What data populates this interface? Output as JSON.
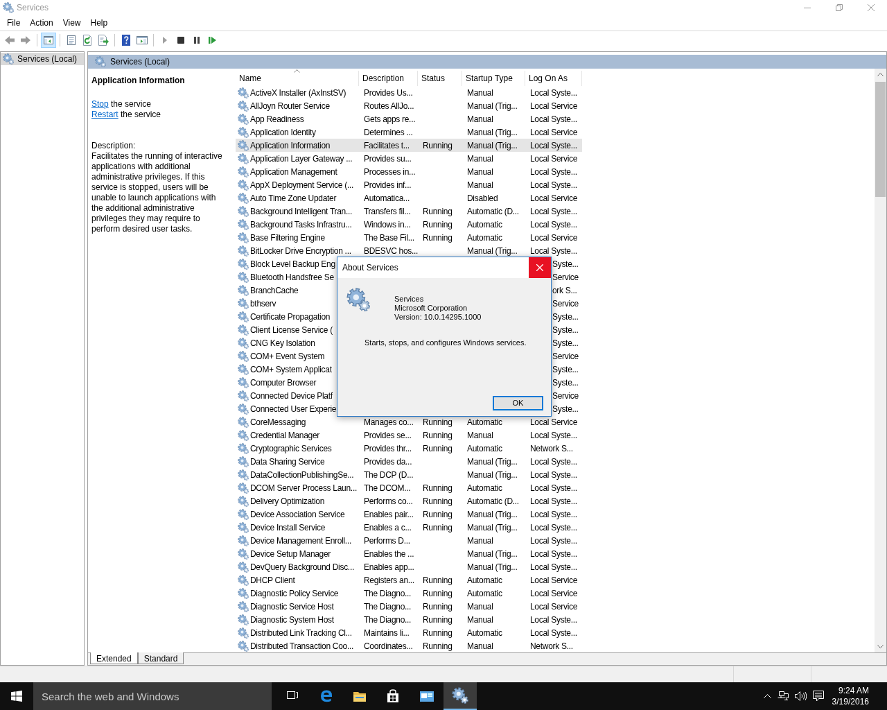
{
  "window": {
    "title": "Services"
  },
  "menu": [
    {
      "label": "File"
    },
    {
      "label": "Action"
    },
    {
      "label": "View"
    },
    {
      "label": "Help"
    }
  ],
  "toolbar": [
    {
      "kind": "back",
      "enabled": false,
      "pressed": false
    },
    {
      "kind": "forward",
      "enabled": false,
      "pressed": false
    },
    {
      "kind": "separator"
    },
    {
      "kind": "tree",
      "enabled": true,
      "pressed": true
    },
    {
      "kind": "separator"
    },
    {
      "kind": "properties",
      "enabled": true,
      "pressed": false
    },
    {
      "kind": "refresh",
      "enabled": true,
      "pressed": false
    },
    {
      "kind": "export",
      "enabled": true,
      "pressed": false
    },
    {
      "kind": "separator"
    },
    {
      "kind": "help",
      "enabled": true,
      "pressed": false
    },
    {
      "kind": "pane",
      "enabled": true,
      "pressed": false
    },
    {
      "kind": "separator"
    },
    {
      "kind": "start",
      "enabled": false,
      "pressed": false
    },
    {
      "kind": "stop",
      "enabled": true,
      "pressed": false
    },
    {
      "kind": "pause",
      "enabled": true,
      "pressed": false
    },
    {
      "kind": "resume",
      "enabled": true,
      "pressed": false
    }
  ],
  "tree": {
    "items": [
      {
        "label": "Services (Local)",
        "selected": true
      }
    ]
  },
  "pane_header": "Services (Local)",
  "details": {
    "title": "Application Information",
    "actions": [
      {
        "link": "Stop",
        "text": " the service"
      },
      {
        "link": "Restart",
        "text": " the service"
      }
    ],
    "description_label": "Description:",
    "description": "Facilitates the running of interactive applications with additional administrative privileges.  If this service is stopped, users will be unable to launch applications with the additional administrative privileges they may require to perform desired user tasks."
  },
  "table": {
    "columns": [
      {
        "label": "Name",
        "sorted": true
      },
      {
        "label": "Description",
        "sorted": false
      },
      {
        "label": "Status",
        "sorted": false
      },
      {
        "label": "Startup Type",
        "sorted": false
      },
      {
        "label": "Log On As",
        "sorted": false
      }
    ],
    "rows": [
      {
        "kind": "full",
        "name": "ActiveX Installer (AxInstSV)",
        "description": "Provides Us...",
        "startup_type": "Manual",
        "log_on_as": "Local Syste...",
        "selected": false
      },
      {
        "kind": "full",
        "name": "AllJoyn Router Service",
        "description": "Routes AllJo...",
        "startup_type": "Manual (Trig...",
        "log_on_as": "Local Service",
        "selected": false
      },
      {
        "kind": "full",
        "name": "App Readiness",
        "description": "Gets apps re...",
        "startup_type": "Manual",
        "log_on_as": "Local Syste...",
        "selected": false
      },
      {
        "kind": "full",
        "name": "Application Identity",
        "description": "Determines ...",
        "startup_type": "Manual (Trig...",
        "log_on_as": "Local Service",
        "selected": false
      },
      {
        "kind": "full",
        "name": "Application Information",
        "description": "Facilitates t...",
        "status": "Running",
        "startup_type": "Manual (Trig...",
        "log_on_as": "Local Syste...",
        "selected": true
      },
      {
        "kind": "full",
        "name": "Application Layer Gateway ...",
        "description": "Provides su...",
        "startup_type": "Manual",
        "log_on_as": "Local Service",
        "selected": false
      },
      {
        "kind": "full",
        "name": "Application Management",
        "description": "Processes in...",
        "startup_type": "Manual",
        "log_on_as": "Local Syste...",
        "selected": false
      },
      {
        "kind": "full",
        "name": "AppX Deployment Service (...",
        "description": "Provides inf...",
        "startup_type": "Manual",
        "log_on_as": "Local Syste...",
        "selected": false
      },
      {
        "kind": "full",
        "name": "Auto Time Zone Updater",
        "description": "Automatica...",
        "startup_type": "Disabled",
        "log_on_as": "Local Service",
        "selected": false
      },
      {
        "kind": "full",
        "name": "Background Intelligent Tran...",
        "description": "Transfers fil...",
        "status": "Running",
        "startup_type": "Automatic (D...",
        "log_on_as": "Local Syste...",
        "selected": false
      },
      {
        "kind": "full",
        "name": "Background Tasks Infrastru...",
        "description": "Windows in...",
        "status": "Running",
        "startup_type": "Automatic",
        "log_on_as": "Local Syste...",
        "selected": false
      },
      {
        "kind": "full",
        "name": "Base Filtering Engine",
        "description": "The Base Fil...",
        "status": "Running",
        "startup_type": "Automatic",
        "log_on_as": "Local Service",
        "selected": false
      },
      {
        "kind": "full",
        "name": "BitLocker Drive Encryption ...",
        "description": "BDESVC hos...",
        "startup_type": "Manual (Trig...",
        "log_on_as": "Local Syste...",
        "selected": false
      },
      {
        "kind": "covered",
        "name": "Block Level Backup Eng",
        "log_on_as": "Syste...",
        "selected": false
      },
      {
        "kind": "covered",
        "name": "Bluetooth Handsfree Se",
        "log_on_as": "Service",
        "selected": false
      },
      {
        "kind": "covered",
        "name": "BranchCache",
        "log_on_as": "ork S...",
        "selected": false
      },
      {
        "kind": "covered",
        "name": "bthserv",
        "log_on_as": "Service",
        "selected": false
      },
      {
        "kind": "covered",
        "name": "Certificate Propagation",
        "log_on_as": "Syste...",
        "selected": false
      },
      {
        "kind": "covered",
        "name": "Client License Service (",
        "log_on_as": "Syste...",
        "selected": false
      },
      {
        "kind": "covered",
        "name": "CNG Key Isolation",
        "log_on_as": "Syste...",
        "selected": false
      },
      {
        "kind": "covered",
        "name": "COM+ Event System",
        "log_on_as": "Service",
        "selected": false
      },
      {
        "kind": "covered",
        "name": "COM+ System Applicat",
        "log_on_as": "Syste...",
        "selected": false
      },
      {
        "kind": "covered",
        "name": "Computer Browser",
        "log_on_as": "Syste...",
        "selected": false
      },
      {
        "kind": "covered",
        "name": "Connected Device Platf",
        "log_on_as": "Service",
        "selected": false
      },
      {
        "kind": "covered",
        "name": "Connected User Experie",
        "log_on_as": "Syste...",
        "selected": false
      },
      {
        "kind": "full",
        "name": "CoreMessaging",
        "description": "Manages co...",
        "status": "Running",
        "startup_type": "Automatic",
        "log_on_as": "Local Service",
        "selected": false
      },
      {
        "kind": "full",
        "name": "Credential Manager",
        "description": "Provides se...",
        "status": "Running",
        "startup_type": "Manual",
        "log_on_as": "Local Syste...",
        "selected": false
      },
      {
        "kind": "full",
        "name": "Cryptographic Services",
        "description": "Provides thr...",
        "status": "Running",
        "startup_type": "Automatic",
        "log_on_as": "Network S...",
        "selected": false
      },
      {
        "kind": "full",
        "name": "Data Sharing Service",
        "description": "Provides da...",
        "startup_type": "Manual (Trig...",
        "log_on_as": "Local Syste...",
        "selected": false
      },
      {
        "kind": "full",
        "name": "DataCollectionPublishingSe...",
        "description": "The DCP (D...",
        "startup_type": "Manual (Trig...",
        "log_on_as": "Local Syste...",
        "selected": false
      },
      {
        "kind": "full",
        "name": "DCOM Server Process Laun...",
        "description": "The DCOM...",
        "status": "Running",
        "startup_type": "Automatic",
        "log_on_as": "Local Syste...",
        "selected": false
      },
      {
        "kind": "full",
        "name": "Delivery Optimization",
        "description": "Performs co...",
        "status": "Running",
        "startup_type": "Automatic (D...",
        "log_on_as": "Local Syste...",
        "selected": false
      },
      {
        "kind": "full",
        "name": "Device Association Service",
        "description": "Enables pair...",
        "status": "Running",
        "startup_type": "Manual (Trig...",
        "log_on_as": "Local Syste...",
        "selected": false
      },
      {
        "kind": "full",
        "name": "Device Install Service",
        "description": "Enables a c...",
        "status": "Running",
        "startup_type": "Manual (Trig...",
        "log_on_as": "Local Syste...",
        "selected": false
      },
      {
        "kind": "full",
        "name": "Device Management Enroll...",
        "description": "Performs D...",
        "startup_type": "Manual",
        "log_on_as": "Local Syste...",
        "selected": false
      },
      {
        "kind": "full",
        "name": "Device Setup Manager",
        "description": "Enables the ...",
        "startup_type": "Manual (Trig...",
        "log_on_as": "Local Syste...",
        "selected": false
      },
      {
        "kind": "full",
        "name": "DevQuery Background Disc...",
        "description": "Enables app...",
        "startup_type": "Manual (Trig...",
        "log_on_as": "Local Syste...",
        "selected": false
      },
      {
        "kind": "full",
        "name": "DHCP Client",
        "description": "Registers an...",
        "status": "Running",
        "startup_type": "Automatic",
        "log_on_as": "Local Service",
        "selected": false
      },
      {
        "kind": "full",
        "name": "Diagnostic Policy Service",
        "description": "The Diagno...",
        "status": "Running",
        "startup_type": "Automatic",
        "log_on_as": "Local Service",
        "selected": false
      },
      {
        "kind": "full",
        "name": "Diagnostic Service Host",
        "description": "The Diagno...",
        "status": "Running",
        "startup_type": "Manual",
        "log_on_as": "Local Service",
        "selected": false
      },
      {
        "kind": "full",
        "name": "Diagnostic System Host",
        "description": "The Diagno...",
        "status": "Running",
        "startup_type": "Manual",
        "log_on_as": "Local Syste...",
        "selected": false
      },
      {
        "kind": "full",
        "name": "Distributed Link Tracking Cl...",
        "description": "Maintains li...",
        "status": "Running",
        "startup_type": "Automatic",
        "log_on_as": "Local Syste...",
        "selected": false
      },
      {
        "kind": "full",
        "name": "Distributed Transaction Coo...",
        "description": "Coordinates...",
        "status": "Running",
        "startup_type": "Manual",
        "log_on_as": "Network S...",
        "selected": false
      }
    ]
  },
  "view_tabs": [
    {
      "label": "Extended",
      "selected": true
    },
    {
      "label": "Standard",
      "selected": false
    }
  ],
  "dialog": {
    "title": "About Services",
    "lines": [
      "Services",
      "Microsoft Corporation",
      "Version: 10.0.14295.1000"
    ],
    "description": "Starts, stops, and configures Windows services.",
    "button": "OK"
  },
  "taskbar": {
    "search_placeholder": "Search the web and Windows",
    "apps": [
      {
        "kind": "task-view",
        "active": false
      },
      {
        "kind": "browser",
        "active": false
      },
      {
        "kind": "folder",
        "active": false
      },
      {
        "kind": "store",
        "active": false
      },
      {
        "kind": "console",
        "active": false
      },
      {
        "kind": "services",
        "active": true
      }
    ],
    "time": "9:24 AM",
    "date": "3/19/2016"
  }
}
